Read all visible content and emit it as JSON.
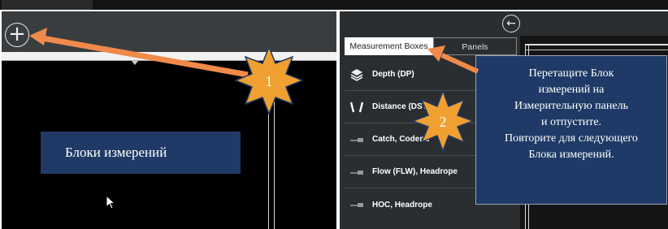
{
  "left_panel": {
    "add_button": "+",
    "box_label": "Блоки измерений"
  },
  "right_panel": {
    "back_button": "←",
    "tabs": [
      "Measurement Boxes",
      "Panels"
    ],
    "items": [
      {
        "label": "Depth (DP)",
        "icon": "layers-icon"
      },
      {
        "label": "Distance (DST)",
        "icon": "distance-icon"
      },
      {
        "label": "Catch, Codend",
        "icon": "sensor-icon"
      },
      {
        "label": "Flow (FLW), Headrope",
        "icon": "sensor-icon"
      },
      {
        "label": "HOC, Headrope",
        "icon": "sensor-icon"
      }
    ]
  },
  "instruction": {
    "lines": [
      "Перетащите Блок",
      "измерений на",
      "Измерительную панель",
      "и отпустите.",
      "Повторите для следующего",
      "Блока измерений."
    ]
  },
  "steps": [
    "1",
    "2"
  ],
  "colors": {
    "callout_blue": "#1f3a66",
    "star_orange": "#f0a030",
    "arrow_orange": "#f08a4a"
  }
}
